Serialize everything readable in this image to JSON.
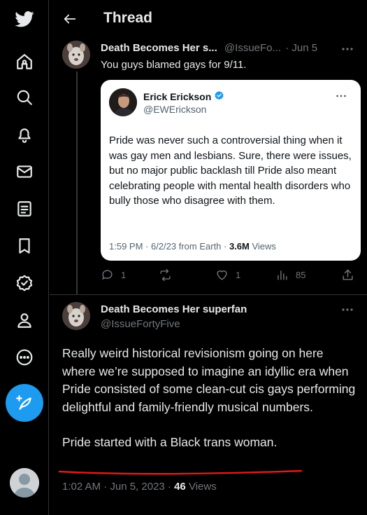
{
  "header": {
    "title": "Thread"
  },
  "tweet1": {
    "display_name": "Death Becomes Her s...",
    "handle": "@IssueFo...",
    "date": "· Jun 5",
    "text": "You guys blamed gays for 9/11.",
    "actions": {
      "replies": "1",
      "retweets": "",
      "likes": "1",
      "views": "85"
    }
  },
  "quote": {
    "display_name": "Erick Erickson",
    "handle": "@EWErickson",
    "text": "Pride was never such a controversial thing when it was gay men and lesbians. Sure, there were issues, but no major public backlash till Pride also meant celebrating people with mental health disorders who bully those who disagree with them.",
    "timestamp": "1:59 PM · 6/2/23 from Earth · ",
    "views_count": "3.6M",
    "views_label": " Views"
  },
  "tweet2": {
    "display_name": "Death Becomes Her superfan",
    "handle": "@IssueFortyFive",
    "paragraph1": "Really weird historical revisionism going on here where we’re supposed to imagine an idyllic era when Pride consisted of some clean-cut cis gays performing delightful and family-friendly musical numbers.",
    "paragraph2": "Pride started with a Black trans woman.",
    "timestamp": "1:02 AM · Jun 5, 2023 · ",
    "views_count": "46",
    "views_label": " Views"
  },
  "colors": {
    "accent": "#1d9bf0",
    "background": "#000000",
    "text": "#e7e9ea",
    "muted": "#71767b",
    "annotation": "#e0191b"
  }
}
